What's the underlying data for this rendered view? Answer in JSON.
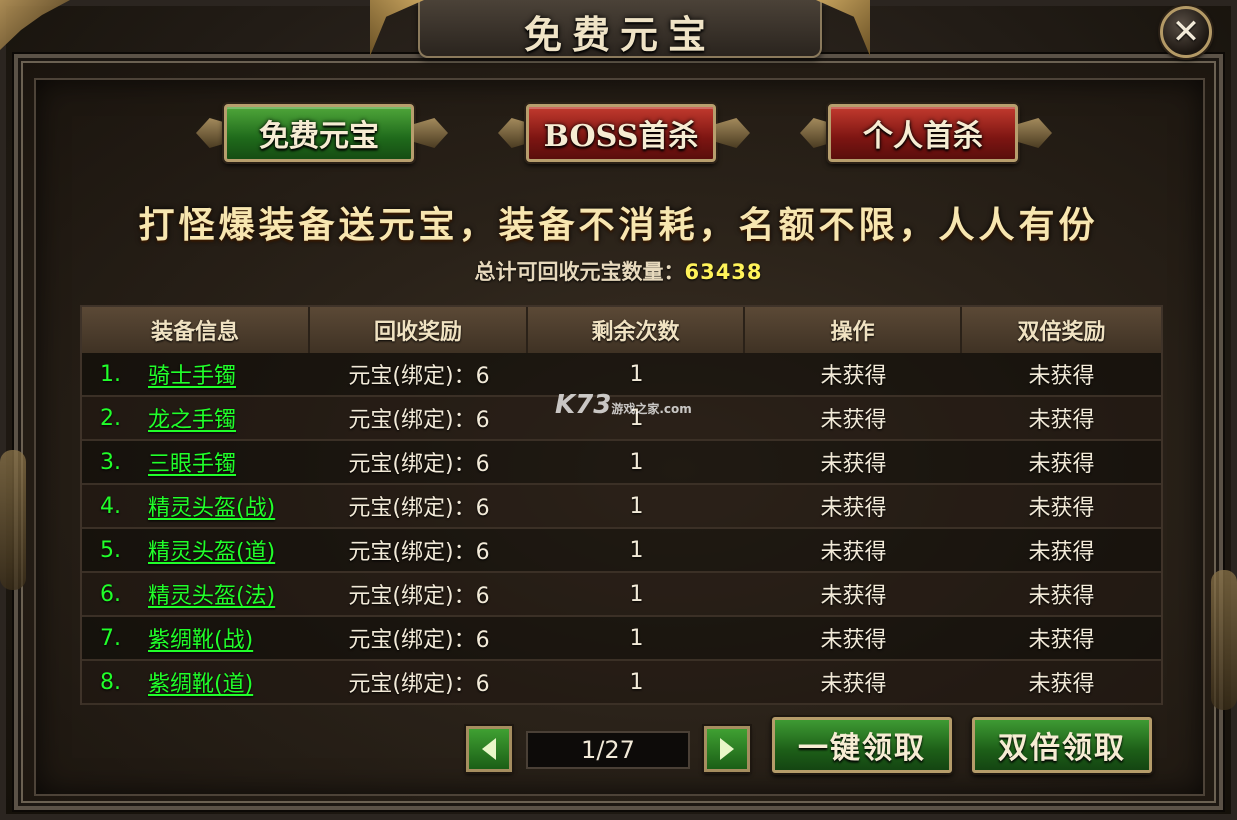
{
  "window": {
    "title": "免费元宝",
    "close_glyph": "✕"
  },
  "tabs": [
    {
      "label": "免费元宝",
      "active": true
    },
    {
      "label": "BOSS首杀",
      "active": false
    },
    {
      "label": "个人首杀",
      "active": false
    }
  ],
  "slogan": "打怪爆装备送元宝，装备不消耗，名额不限，人人有份",
  "total": {
    "label": "总计可回收元宝数量：",
    "value": "63438"
  },
  "table": {
    "headers": [
      "装备信息",
      "回收奖励",
      "剩余次数",
      "操作",
      "双倍奖励"
    ],
    "rows": [
      {
        "index": "1.",
        "name": "骑士手镯",
        "reward": "元宝(绑定)：6",
        "remaining": "1",
        "action": "未获得",
        "double": "未获得"
      },
      {
        "index": "2.",
        "name": "龙之手镯",
        "reward": "元宝(绑定)：6",
        "remaining": "1",
        "action": "未获得",
        "double": "未获得"
      },
      {
        "index": "3.",
        "name": "三眼手镯",
        "reward": "元宝(绑定)：6",
        "remaining": "1",
        "action": "未获得",
        "double": "未获得"
      },
      {
        "index": "4.",
        "name": "精灵头盔(战)",
        "reward": "元宝(绑定)：6",
        "remaining": "1",
        "action": "未获得",
        "double": "未获得"
      },
      {
        "index": "5.",
        "name": "精灵头盔(道)",
        "reward": "元宝(绑定)：6",
        "remaining": "1",
        "action": "未获得",
        "double": "未获得"
      },
      {
        "index": "6.",
        "name": "精灵头盔(法)",
        "reward": "元宝(绑定)：6",
        "remaining": "1",
        "action": "未获得",
        "double": "未获得"
      },
      {
        "index": "7.",
        "name": "紫绸靴(战)",
        "reward": "元宝(绑定)：6",
        "remaining": "1",
        "action": "未获得",
        "double": "未获得"
      },
      {
        "index": "8.",
        "name": "紫绸靴(道)",
        "reward": "元宝(绑定)：6",
        "remaining": "1",
        "action": "未获得",
        "double": "未获得"
      }
    ]
  },
  "watermark": {
    "brand": "K73",
    "sub": "游戏之家",
    "domain": ".com"
  },
  "pager": {
    "page": "1/27"
  },
  "actions": {
    "claim_all": "一键领取",
    "claim_double": "双倍领取"
  },
  "colors": {
    "item_green": "#21ff2a",
    "total_yellow": "#fff35a",
    "tab_green": "#2f8a27",
    "tab_red": "#a3241c"
  }
}
